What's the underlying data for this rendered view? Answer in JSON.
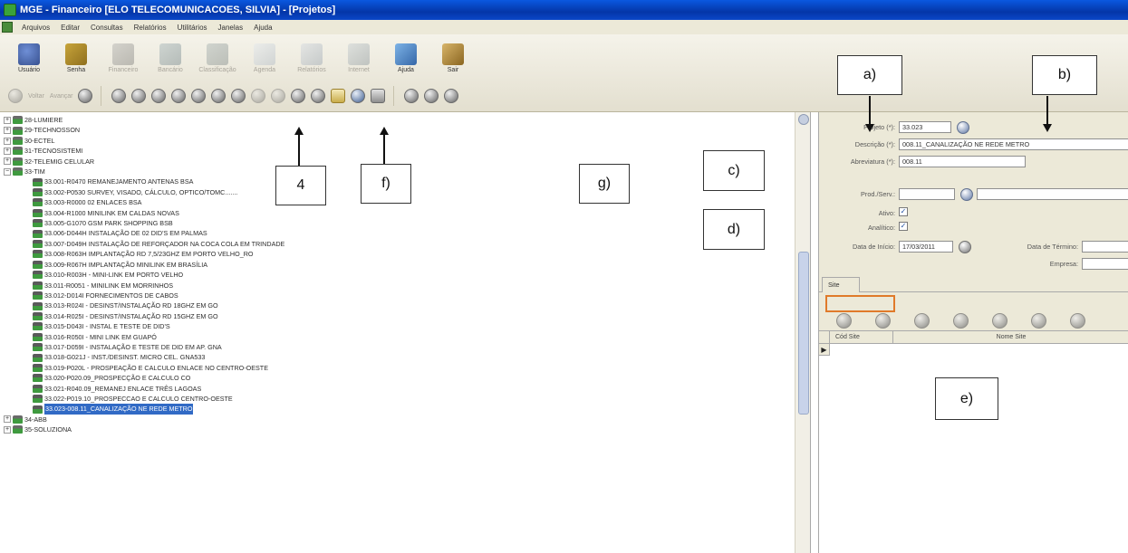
{
  "window": {
    "title": "MGE - Financeiro [ELO TELECOMUNICACOES, SILVIA] - [Projetos]"
  },
  "menu": [
    "Arquivos",
    "Editar",
    "Consultas",
    "Relatórios",
    "Utilitários",
    "Janelas",
    "Ajuda"
  ],
  "toolbar": {
    "buttons": [
      {
        "label": "Usuário",
        "icon": "user-icon",
        "enabled": true
      },
      {
        "label": "Senha",
        "icon": "key-icon",
        "enabled": true
      },
      {
        "label": "Financeiro",
        "icon": "finance-icon",
        "enabled": false
      },
      {
        "label": "Bancário",
        "icon": "bank-icon",
        "enabled": false
      },
      {
        "label": "Classificação",
        "icon": "tools-icon",
        "enabled": false
      },
      {
        "label": "Agenda",
        "icon": "document-icon",
        "enabled": false
      },
      {
        "label": "Relatórios",
        "icon": "report-icon",
        "enabled": false
      },
      {
        "label": "Internet",
        "icon": "computer-icon",
        "enabled": false
      },
      {
        "label": "Ajuda",
        "icon": "help-icon",
        "enabled": true
      },
      {
        "label": "Sair",
        "icon": "exit-icon",
        "enabled": true
      }
    ],
    "nav": {
      "back_label": "Voltar",
      "forward_label": "Avançar"
    }
  },
  "tree": {
    "nodes_before": [
      {
        "label": "28-LUMIERE",
        "expander": "+"
      },
      {
        "label": "29-TECHNOSSON",
        "expander": "+"
      },
      {
        "label": "30-ECTEL",
        "expander": "+"
      },
      {
        "label": "31-TECNOSISTEMI",
        "expander": "+"
      },
      {
        "label": "32-TELEMIG CELULAR",
        "expander": "+"
      },
      {
        "label": "33-TIM",
        "expander": "−"
      }
    ],
    "children": [
      "33.001-R0470 REMANEJAMENTO ANTENAS BSA",
      "33.002-P0530 SURVEY, VISADO, CÁLCULO, OPTICO/TOMC.......",
      "33.003-R0000 02 ENLACES BSA",
      "33.004-R1000 MINILINK EM CALDAS NOVAS",
      "33.005-G1070 GSM PARK SHOPPING BSB",
      "33.006-D044H INSTALAÇÃO DE 02 DID'S EM PALMAS",
      "33.007-D049H INSTALAÇÃO DE REFORÇADOR NA COCA COLA EM TRINDADE",
      "33.008-R063H IMPLANTAÇÃO RD 7,5/23GHZ EM PORTO VELHO_RO",
      "33.009-R067H IMPLANTAÇÃO MINILINK EM BRASÍLIA",
      "33.010-R003H - MINI-LINK EM PORTO VELHO",
      "33.011-R0051 - MINILINK EM MORRINHOS",
      "33.012-D014I FORNECIMENTOS DE CABOS",
      "33.013-R024I - DESINST/INSTALAÇÃO RD 18GHZ EM GO",
      "33.014-R025I - DESINST/INSTALAÇÃO RD 15GHZ EM GO",
      "33.015-D043I - INSTAL E TESTE DE DID'S",
      "33.016-R050I - MINI LINK EM GUAPÓ",
      "33.017-D059I - INSTALAÇÃO E TESTE DE DID EM AP. GNA",
      "33.018-G021J - INST./DESINST. MICRO CEL. GNA533",
      "33.019-P020L - PROSPEAÇÃO E CALCULO ENLACE NO CENTRO-OESTE",
      "33.020-P020.09_PROSPECÇÃO E CALCULO CO",
      "33.021-R040.09_REMANEJ ENLACE TRÊS LAGOAS",
      "33.022-P019.10_PROSPECCAO E CALCULO CENTRO-OESTE",
      "33.023-008.11_CANALIZAÇÃO NE REDE METRO"
    ],
    "selected_index": 22,
    "nodes_after": [
      {
        "label": "34-ABB",
        "expander": "+"
      },
      {
        "label": "35-SOLUZIONA",
        "expander": "+"
      }
    ]
  },
  "form": {
    "projeto_label": "Projeto (*):",
    "projeto_value": "33.023",
    "descricao_label": "Descrição (*):",
    "descricao_value": "008.11_CANALIZAÇÃO NE REDE METRO",
    "abreviatura_label": "Abreviatura (*):",
    "abreviatura_value": "008.11",
    "prodserv_label": "Prod./Serv.:",
    "prodserv_value": "",
    "ativo_label": "Ativo:",
    "ativo_checked": true,
    "analitico_label": "Analítico:",
    "analitico_checked": true,
    "data_inicio_label": "Data de Início:",
    "data_inicio_value": "17/03/2011",
    "data_termino_label": "Data de Término:",
    "data_termino_value": "",
    "empresa_label": "Empresa:",
    "empresa_value": ""
  },
  "site_tab": {
    "tab_label": "Site",
    "columns": [
      "Cód Site",
      "Nome Site"
    ],
    "row_indicator": "▶"
  },
  "annotations": {
    "a": "a)",
    "b": "b)",
    "c": "c)",
    "d": "d)",
    "e": "e)",
    "f": "f)",
    "g": "g)",
    "four": "4"
  }
}
